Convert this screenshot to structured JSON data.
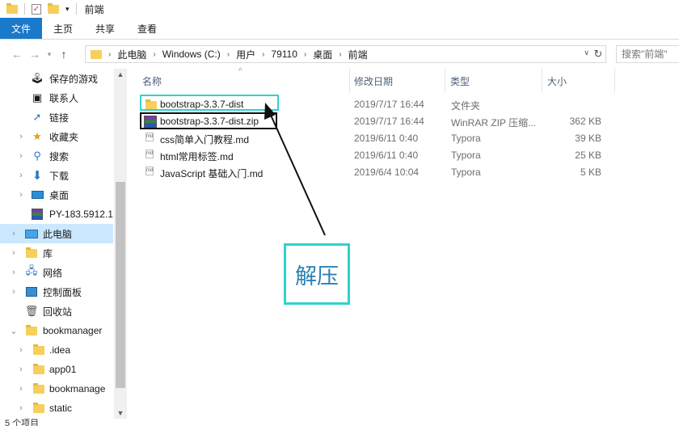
{
  "window": {
    "title": "前端"
  },
  "ribbon": {
    "tabs": [
      "文件",
      "主页",
      "共享",
      "查看"
    ]
  },
  "address": {
    "crumbs": [
      "此电脑",
      "Windows (C:)",
      "用户",
      "79110",
      "桌面",
      "前端"
    ],
    "search_placeholder": "搜索\"前端\""
  },
  "nav": {
    "items": [
      {
        "label": "保存的游戏",
        "icon": "saved-games-icon"
      },
      {
        "label": "联系人",
        "icon": "contacts-icon"
      },
      {
        "label": "链接",
        "icon": "links-icon"
      },
      {
        "label": "收藏夹",
        "icon": "favorites-icon"
      },
      {
        "label": "搜索",
        "icon": "search-icon"
      },
      {
        "label": "下载",
        "icon": "download-icon"
      },
      {
        "label": "桌面",
        "icon": "desktop-icon"
      },
      {
        "label": "PY-183.5912.1",
        "icon": "winrar-icon"
      },
      {
        "label": "此电脑",
        "icon": "this-pc-icon"
      },
      {
        "label": "库",
        "icon": "library-icon"
      },
      {
        "label": "网络",
        "icon": "network-icon"
      },
      {
        "label": "控制面板",
        "icon": "control-panel-icon"
      },
      {
        "label": "回收站",
        "icon": "recycle-bin-icon"
      },
      {
        "label": "bookmanager",
        "icon": "folder-icon"
      },
      {
        "label": ".idea",
        "icon": "folder-icon"
      },
      {
        "label": "app01",
        "icon": "folder-icon"
      },
      {
        "label": "bookmanage",
        "icon": "folder-icon"
      },
      {
        "label": "static",
        "icon": "folder-icon"
      }
    ]
  },
  "columns": {
    "name": "名称",
    "date": "修改日期",
    "type": "类型",
    "size": "大小"
  },
  "files": [
    {
      "name": "bootstrap-3.3.7-dist",
      "date": "2019/7/17 16:44",
      "type": "文件夹",
      "size": "",
      "icon": "folder-icon"
    },
    {
      "name": "bootstrap-3.3.7-dist.zip",
      "date": "2019/7/17 16:44",
      "type": "WinRAR ZIP 压缩...",
      "size": "362 KB",
      "icon": "winrar-icon"
    },
    {
      "name": "css简单入门教程.md",
      "date": "2019/6/11 0:40",
      "type": "Typora",
      "size": "39 KB",
      "icon": "markdown-icon"
    },
    {
      "name": "html常用标签.md",
      "date": "2019/6/11 0:40",
      "type": "Typora",
      "size": "25 KB",
      "icon": "markdown-icon"
    },
    {
      "name": "JavaScript 基础入门.md",
      "date": "2019/6/4 10:04",
      "type": "Typora",
      "size": "5 KB",
      "icon": "markdown-icon"
    }
  ],
  "annotation": {
    "callout": "解压"
  },
  "status": {
    "text": "5 个项目"
  }
}
